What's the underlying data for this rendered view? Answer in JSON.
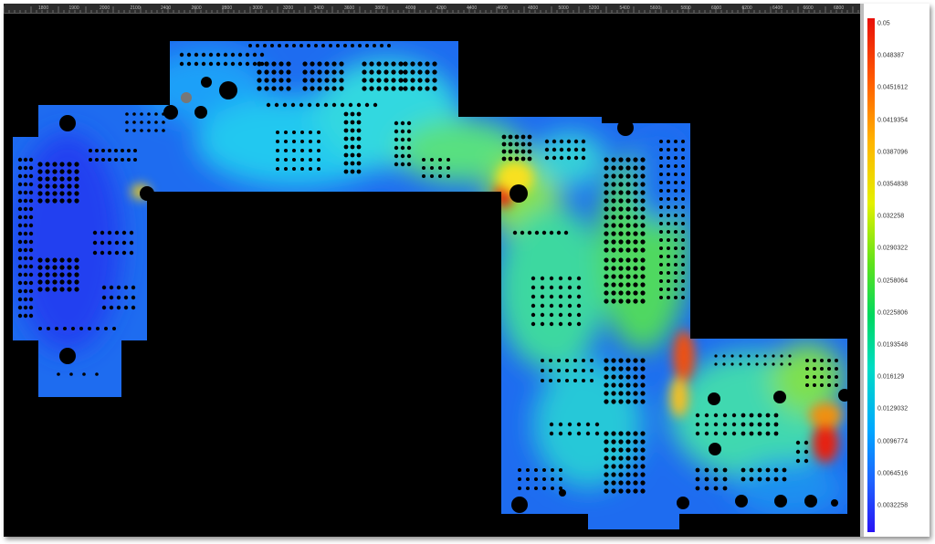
{
  "ruler": {
    "labels": [
      "1800",
      "1900",
      "2000",
      "2100",
      "2400",
      "2600",
      "2800",
      "3000",
      "3200",
      "3400",
      "3600",
      "3800",
      "4000",
      "4200",
      "4400",
      "4600",
      "4800",
      "5000",
      "5200",
      "5400",
      "5600",
      "5800",
      "6000",
      "6200",
      "6400",
      "6600",
      "6800",
      "7000"
    ]
  },
  "colorbar": {
    "labels": [
      "0.05",
      "0.048387",
      "0.0451612",
      "0.0419354",
      "0.0387096",
      "0.0354838",
      "0.032258",
      "0.0290322",
      "0.0258064",
      "0.0225806",
      "0.0193548",
      "0.016129",
      "0.0129032",
      "0.0096774",
      "0.0064516",
      "0.0032258"
    ],
    "colors": [
      "#e8100a",
      "#ff5a00",
      "#ffb400",
      "#e4f000",
      "#5de21c",
      "#00d860",
      "#00dcc4",
      "#00a8ff",
      "#1e64ff",
      "#2814f5"
    ]
  },
  "heatmap": {
    "background": "#000000",
    "base_color": "#1e6cf0",
    "hotspot_color": "#e81a0a"
  }
}
